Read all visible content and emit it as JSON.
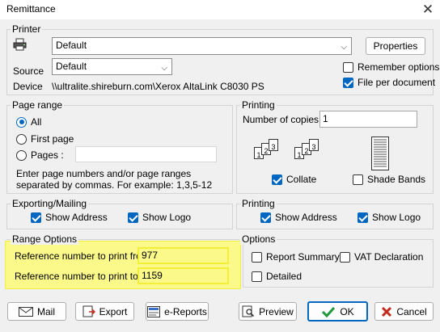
{
  "window": {
    "title": "Remittance",
    "close_glyph": "✕"
  },
  "printer": {
    "group_label": "Printer",
    "printer_value": "Default",
    "properties_label": "Properties",
    "source_label": "Source",
    "source_value": "Default",
    "device_label": "Device",
    "device_value": "\\\\ultralite.shireburn.com\\Xerox AltaLink C8030 PS",
    "remember_options_label": "Remember options",
    "remember_options_checked": false,
    "file_per_document_label": "File per document",
    "file_per_document_checked": true
  },
  "page_range": {
    "group_label": "Page range",
    "all_label": "All",
    "first_page_label": "First page",
    "pages_label": "Pages :",
    "pages_value": "",
    "selected": "All",
    "help_text": "Enter page numbers and/or page ranges separated by commas. For example: 1,3,5-12"
  },
  "printing": {
    "group_label": "Printing",
    "copies_label": "Number of copies",
    "copies_value": "1",
    "collate_label": "Collate",
    "collate_checked": true,
    "shade_bands_label": "Shade Bands",
    "shade_bands_checked": false,
    "page_numbers": [
      "1",
      "2",
      "3"
    ]
  },
  "exporting": {
    "group_label": "Exporting/Mailing",
    "show_address_label": "Show Address",
    "show_address_checked": true,
    "show_logo_label": "Show Logo",
    "show_logo_checked": true
  },
  "printing2": {
    "group_label": "Printing",
    "show_address_label": "Show Address",
    "show_address_checked": true,
    "show_logo_label": "Show Logo",
    "show_logo_checked": true
  },
  "range_options": {
    "group_label": "Range Options",
    "from_label": "Reference number to print from",
    "from_value": "977",
    "to_label": "Reference number to print to",
    "to_value": "1159"
  },
  "options": {
    "group_label": "Options",
    "report_summary_label": "Report Summary",
    "report_summary_checked": false,
    "vat_declaration_label": "VAT Declaration",
    "vat_declaration_checked": false,
    "detailed_label": "Detailed",
    "detailed_checked": false
  },
  "buttons": {
    "mail": "Mail",
    "export": "Export",
    "ereports": "e-Reports",
    "preview": "Preview",
    "ok": "OK",
    "cancel": "Cancel"
  },
  "colors": {
    "accent": "#0067c0",
    "highlight": "#fbf98a",
    "ok_check": "#1e9a3c",
    "cancel_x": "#c42b1c"
  }
}
